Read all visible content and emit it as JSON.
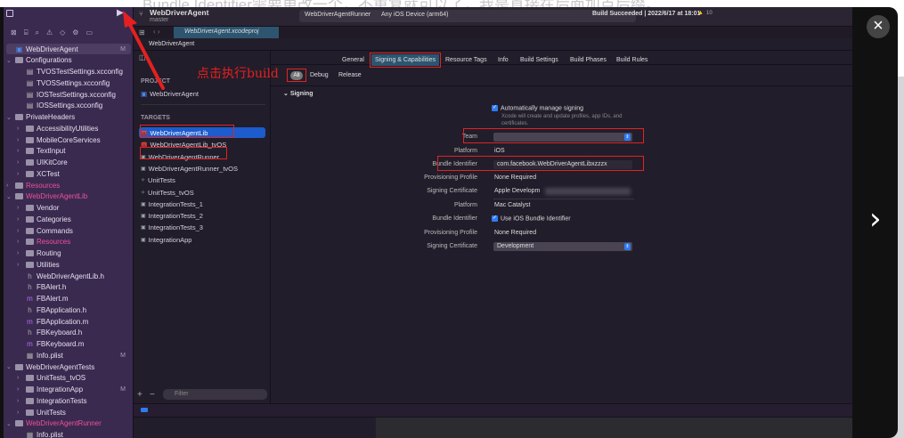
{
  "background_caption": "Bundle Identifier需要更改一个，不重复就可以了，我是直接在后面加点后缀。",
  "annotation": "点击执行build",
  "toolbar": {
    "project": "WebDriverAgent",
    "branch": "master",
    "scheme": "WebDriverAgentRunner",
    "device": "Any iOS Device (arm64)",
    "status": "Build Succeeded | 2022/6/17 at 18:01",
    "warnings": "10"
  },
  "editor_tab": "WebDriverAgent.xcodeproj",
  "jump_bar": "WebDriverAgent",
  "navigator": [
    {
      "label": "WebDriverAgent",
      "level": 0,
      "type": "project",
      "badge": "M"
    },
    {
      "label": "Configurations",
      "level": 0,
      "type": "folder",
      "open": true
    },
    {
      "label": "TVOSTestSettings.xcconfig",
      "level": 1,
      "type": "file"
    },
    {
      "label": "TVOSSettings.xcconfig",
      "level": 1,
      "type": "file"
    },
    {
      "label": "IOSTestSettings.xcconfig",
      "level": 1,
      "type": "file"
    },
    {
      "label": "IOSSettings.xcconfig",
      "level": 1,
      "type": "file"
    },
    {
      "label": "PrivateHeaders",
      "level": 0,
      "type": "folder",
      "open": true
    },
    {
      "label": "AccessibilityUtilities",
      "level": 1,
      "type": "folder"
    },
    {
      "label": "MobileCoreServices",
      "level": 1,
      "type": "folder"
    },
    {
      "label": "TextInput",
      "level": 1,
      "type": "folder"
    },
    {
      "label": "UIKitCore",
      "level": 1,
      "type": "folder"
    },
    {
      "label": "XCTest",
      "level": 1,
      "type": "folder"
    },
    {
      "label": "Resources",
      "level": 0,
      "type": "folder",
      "pink": true
    },
    {
      "label": "WebDriverAgentLib",
      "level": 0,
      "type": "folder",
      "open": true,
      "pink": true
    },
    {
      "label": "Vendor",
      "level": 1,
      "type": "folder"
    },
    {
      "label": "Categories",
      "level": 1,
      "type": "folder"
    },
    {
      "label": "Commands",
      "level": 1,
      "type": "folder"
    },
    {
      "label": "Resources",
      "level": 1,
      "type": "folder",
      "pink": true
    },
    {
      "label": "Routing",
      "level": 1,
      "type": "folder"
    },
    {
      "label": "Utilities",
      "level": 1,
      "type": "folder"
    },
    {
      "label": "WebDriverAgentLib.h",
      "level": 1,
      "type": "h"
    },
    {
      "label": "FBAlert.h",
      "level": 1,
      "type": "h"
    },
    {
      "label": "FBAlert.m",
      "level": 1,
      "type": "m"
    },
    {
      "label": "FBApplication.h",
      "level": 1,
      "type": "h"
    },
    {
      "label": "FBApplication.m",
      "level": 1,
      "type": "m"
    },
    {
      "label": "FBKeyboard.h",
      "level": 1,
      "type": "h"
    },
    {
      "label": "FBKeyboard.m",
      "level": 1,
      "type": "m"
    },
    {
      "label": "Info.plist",
      "level": 1,
      "type": "plist",
      "badge": "M"
    },
    {
      "label": "WebDriverAgentTests",
      "level": 0,
      "type": "folder",
      "open": true
    },
    {
      "label": "UnitTests_tvOS",
      "level": 1,
      "type": "folder"
    },
    {
      "label": "IntegrationApp",
      "level": 1,
      "type": "folder",
      "badge": "M"
    },
    {
      "label": "IntegrationTests",
      "level": 1,
      "type": "folder"
    },
    {
      "label": "UnitTests",
      "level": 1,
      "type": "folder"
    },
    {
      "label": "WebDriverAgentRunner",
      "level": 0,
      "type": "folder",
      "open": true,
      "pink": true
    },
    {
      "label": "Info.plist",
      "level": 1,
      "type": "plist"
    }
  ],
  "project_header": "PROJECT",
  "project_item": "WebDriverAgent",
  "targets_header": "TARGETS",
  "targets": [
    "WebDriverAgentLib",
    "WebDriverAgentLib_tvOS",
    "WebDriverAgentRunner",
    "WebDriverAgentRunner_tvOS",
    "UnitTests",
    "UnitTests_tvOS",
    "IntegrationTests_1",
    "IntegrationTests_2",
    "IntegrationTests_3",
    "IntegrationApp"
  ],
  "filter_placeholder": "Filter",
  "tabs": [
    "General",
    "Signing & Capabilities",
    "Resource Tags",
    "Info",
    "Build Settings",
    "Build Phases",
    "Build Rules"
  ],
  "config_tabs": [
    "All",
    "Debug",
    "Release"
  ],
  "signing": {
    "section": "Signing",
    "auto_label": "Automatically manage signing",
    "auto_desc": "Xcode will create and update profiles, app IDs, and certificates.",
    "team_label": "Team",
    "team_value": "",
    "platform_label": "Platform",
    "platform_ios": "iOS",
    "bundle_label": "Bundle Identifier",
    "bundle_value": "com.facebook.WebDriverAgentLibxzzzx",
    "prov_label": "Provisioning Profile",
    "prov_value": "None Required",
    "cert_label": "Signing Certificate",
    "cert_value": "Apple Developm",
    "platform_mac": "Mac Catalyst",
    "use_ios_bundle": "Use iOS Bundle Identifier",
    "cert_mac_value": "Development"
  },
  "viewer": {
    "close": "×",
    "next": "›"
  }
}
